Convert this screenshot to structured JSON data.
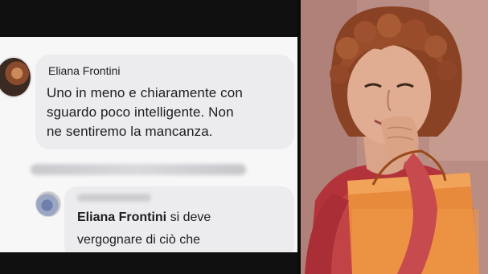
{
  "comment": {
    "author": "Eliana Frontini",
    "text_line1": "Uno in meno e chiaramente con",
    "text_line2": "sguardo poco intelligente. Non",
    "text_line3": "ne sentiremo la mancanza."
  },
  "reply": {
    "mention": "Eliana Frontini",
    "text_after_mention": " si deve",
    "text_line2": "vergognare di ciò che"
  },
  "colors": {
    "background_dark": "#101010",
    "bubble": "#ececee",
    "text": "#1d1d20"
  }
}
